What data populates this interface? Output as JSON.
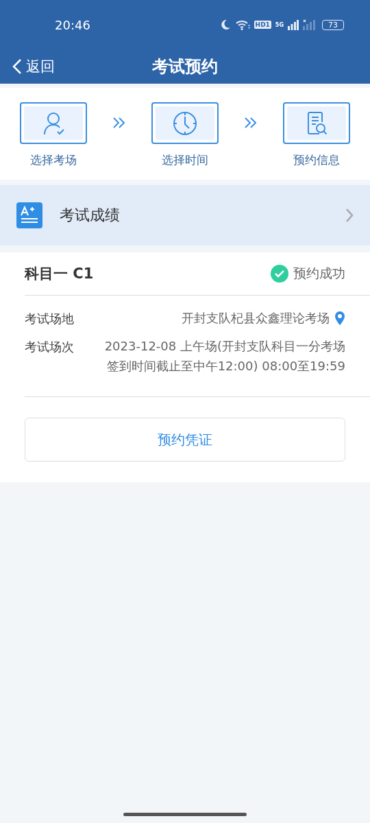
{
  "status_bar": {
    "time": "20:46",
    "hd": "HD1",
    "network": "5G",
    "battery": "73"
  },
  "nav": {
    "back": "返回",
    "title": "考试预约"
  },
  "steps": [
    {
      "kind": "person",
      "label": "选择考场"
    },
    {
      "kind": "clock",
      "label": "选择时间"
    },
    {
      "kind": "document",
      "label": "预约信息"
    }
  ],
  "score_row": {
    "label": "考试成绩"
  },
  "booking": {
    "subject": "科目一 C1",
    "status": "预约成功",
    "success": true,
    "fields": [
      {
        "label": "考试场地",
        "value": "开封支队杞县众鑫理论考场",
        "location": true
      },
      {
        "label": "考试场次",
        "value": "2023-12-08 上午场(开封支队科目一分考场签到时间截止至中午12:00) 08:00至19:59",
        "location": false
      }
    ],
    "button": "预约凭证"
  }
}
